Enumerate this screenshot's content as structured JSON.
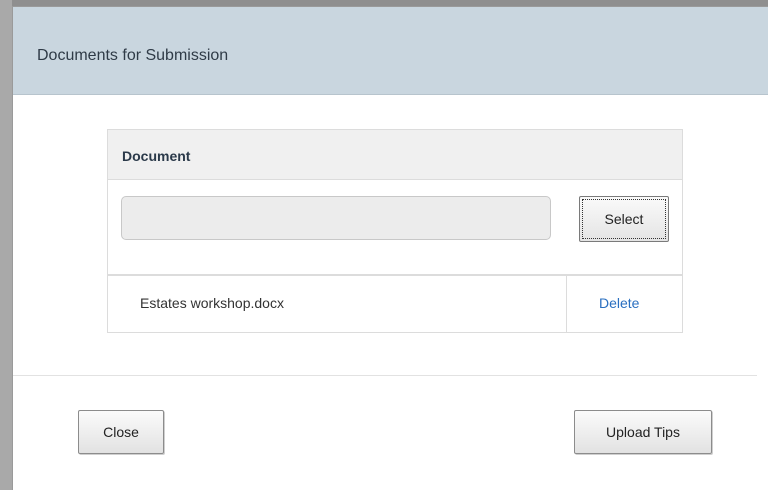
{
  "dialog": {
    "title": "Documents for Submission"
  },
  "table": {
    "header": "Document",
    "file_input": {
      "value": "",
      "placeholder": ""
    },
    "select_label": "Select",
    "rows": [
      {
        "file_name": "Estates workshop.docx",
        "delete_label": "Delete"
      }
    ]
  },
  "footer": {
    "close_label": "Close",
    "upload_tips_label": "Upload Tips"
  },
  "colors": {
    "header_bg": "#c9d6df",
    "link": "#2a6fc0",
    "table_header_bg": "#f0f0f0"
  }
}
